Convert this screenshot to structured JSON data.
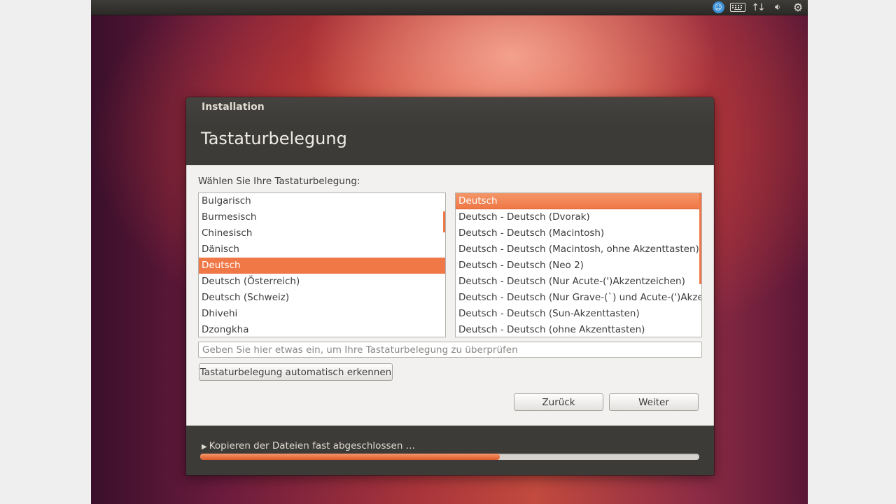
{
  "window": {
    "title": "Installation",
    "page_title": "Tastaturbelegung"
  },
  "layout_picker": {
    "prompt": "Wählen Sie Ihre Tastaturbelegung:",
    "languages": [
      "Bulgarisch",
      "Burmesisch",
      "Chinesisch",
      "Dänisch",
      "Deutsch",
      "Deutsch (Österreich)",
      "Deutsch (Schweiz)",
      "Dhivehi",
      "Dzongkha"
    ],
    "selected_language": "Deutsch",
    "variants": [
      "Deutsch",
      "Deutsch - Deutsch (Dvorak)",
      "Deutsch - Deutsch (Macintosh)",
      "Deutsch - Deutsch (Macintosh, ohne Akzenttasten)",
      "Deutsch - Deutsch (Neo 2)",
      "Deutsch - Deutsch (Nur Acute-(')Akzentzeichen)",
      "Deutsch - Deutsch (Nur Grave-(`) und Acute-(')Akzentzeichen)",
      "Deutsch - Deutsch (Sun-Akzenttasten)",
      "Deutsch - Deutsch (ohne Akzenttasten)"
    ],
    "selected_variant": "Deutsch",
    "test_placeholder": "Geben Sie hier etwas ein, um Ihre Tastaturbelegung zu überprüfen",
    "test_value": "",
    "detect_label": "Tastaturbelegung automatisch erkennen"
  },
  "navigation": {
    "back_label": "Zurück",
    "forward_label": "Weiter"
  },
  "progress": {
    "status": "Kopieren der Dateien fast abgeschlossen …",
    "fraction": 0.6
  },
  "panel": {
    "icons": [
      "accessibility-icon",
      "keyboard-icon",
      "network-icon",
      "sound-icon",
      "session-gear-icon"
    ]
  },
  "colors": {
    "accent": "#f07746",
    "header_bg": "#3c3b37",
    "content_bg": "#f2f1f0"
  }
}
